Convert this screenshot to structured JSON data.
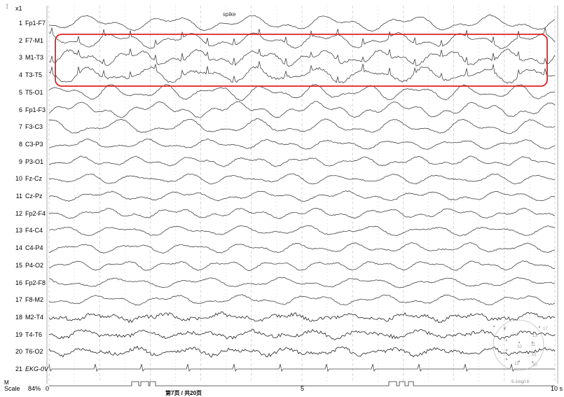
{
  "header": {
    "gain_label": "x1",
    "annotation": "spike"
  },
  "channels": [
    {
      "num": "1",
      "name": "Fp1-F7"
    },
    {
      "num": "2",
      "name": "F7-M1"
    },
    {
      "num": "3",
      "name": "M1-T3"
    },
    {
      "num": "4",
      "name": "T3-T5"
    },
    {
      "num": "5",
      "name": "T5-O1"
    },
    {
      "num": "6",
      "name": "Fp1-F3"
    },
    {
      "num": "7",
      "name": "F3-C3"
    },
    {
      "num": "8",
      "name": "C3-P3"
    },
    {
      "num": "9",
      "name": "P3-O1"
    },
    {
      "num": "10",
      "name": "Fz-Cz"
    },
    {
      "num": "11",
      "name": "Cz-Pz"
    },
    {
      "num": "12",
      "name": "Fp2-F4"
    },
    {
      "num": "13",
      "name": "F4-C4"
    },
    {
      "num": "14",
      "name": "C4-P4"
    },
    {
      "num": "15",
      "name": "P4-O2"
    },
    {
      "num": "16",
      "name": "Fp2-F8"
    },
    {
      "num": "17",
      "name": "F8-M2"
    },
    {
      "num": "18",
      "name": "M2-T4"
    },
    {
      "num": "19",
      "name": "T4-T6"
    },
    {
      "num": "20",
      "name": "T6-O2"
    },
    {
      "num": "21",
      "name": "EKG-0V"
    }
  ],
  "footer": {
    "scale_label": "Scale",
    "scale_value": "84%",
    "m_label": "M",
    "time_start": "0",
    "time_mid": "5",
    "time_end": "10 s",
    "page_info": "第7页 / 共20页",
    "montage_note": "5-1mg/l 8"
  },
  "highlight": {
    "color": "#e02020",
    "channels": [
      "F7-M1",
      "M1-T3",
      "T3-T5"
    ]
  },
  "head_map_numbers": [
    "2",
    "17",
    "13",
    "10",
    "11",
    "12",
    "15",
    "20"
  ]
}
